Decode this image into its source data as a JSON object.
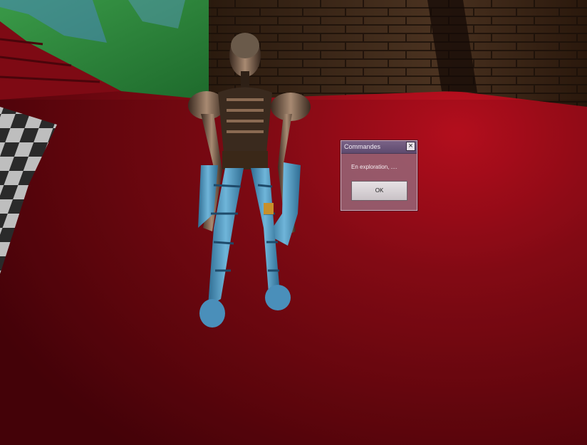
{
  "dialog": {
    "title": "Commandes",
    "close_icon": "close-icon",
    "message": "En exploration, ....",
    "ok_label": "OK"
  },
  "scene": {
    "floor_color": "#8a0a14",
    "wall_color": "#3a2414",
    "character": "skeletal humanoid with blue striped legs"
  }
}
